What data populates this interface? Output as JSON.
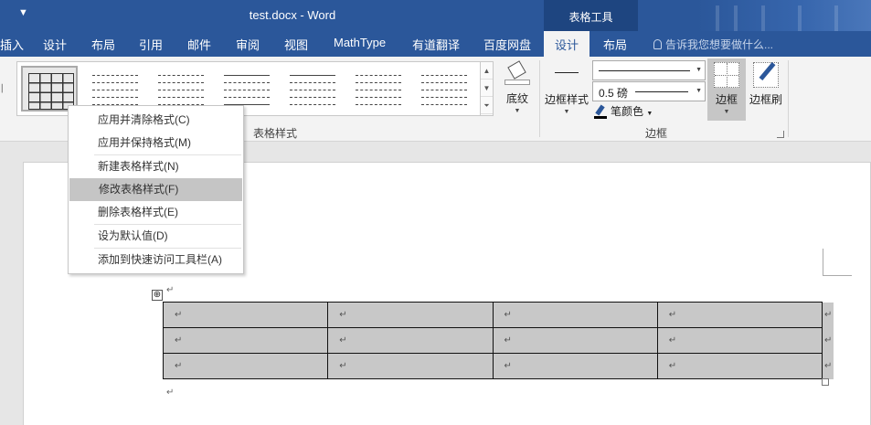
{
  "window": {
    "title": "test.docx - Word",
    "qat_icon": "customize-qat-icon",
    "contextual_group": "表格工具"
  },
  "tabs": {
    "items": [
      "插入",
      "设计",
      "布局",
      "引用",
      "邮件",
      "审阅",
      "视图",
      "MathType",
      "有道翻译",
      "百度网盘"
    ],
    "ctx_design": "设计",
    "ctx_layout": "布局",
    "tellme": "告诉我您想要做什么..."
  },
  "ribbon": {
    "table_styles_group": "表格样式",
    "shading_label": "底纹",
    "border_styles_label": "边框样式",
    "pen_weight": "0.5 磅",
    "pen_color_label": "笔颜色",
    "borders_label": "边框",
    "border_painter_label": "边框刷",
    "borders_group": "边框"
  },
  "context_menu": {
    "items": [
      "应用并清除格式(C)",
      "应用并保持格式(M)",
      "新建表格样式(N)",
      "修改表格样式(F)",
      "删除表格样式(E)",
      "设为默认值(D)",
      "添加到快速访问工具栏(A)"
    ],
    "highlighted_index": 3
  },
  "document": {
    "paragraph_mark": "↵",
    "table": {
      "rows": 3,
      "cols": 4,
      "cell_mark": "↵",
      "shading": "#c8c8c8"
    },
    "move_handle_glyph": "⊕"
  },
  "colors": {
    "title_bar": "#2b579a",
    "contextual": "#1e4580",
    "ribbon": "#f3f3f3",
    "menu_hover": "#c5c5c5"
  }
}
